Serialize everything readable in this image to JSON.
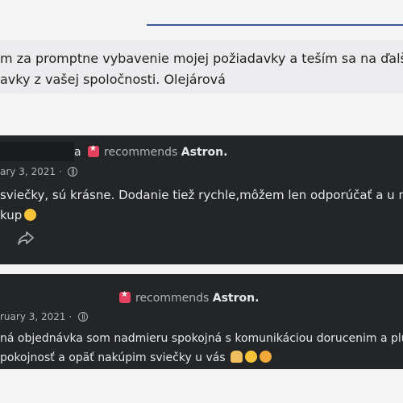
{
  "quote": {
    "line1": "m za promptne vybavenie mojej požiadavky a teším sa na ďalšie",
    "line2": "avky z vašej spoločnosti. Olejárová"
  },
  "reviews": [
    {
      "name_fragment": "a",
      "recommends": "recommends",
      "page": "Astron.",
      "date": "ary 3, 2021 ·",
      "text_line1": "sviečky, sú krásne. Dodanie tiež rychle,môžem len odporúčať a u mňa to",
      "text_line2": "kup"
    },
    {
      "recommends": "recommends",
      "page": "Astron.",
      "date": "ruary 3, 2021 ·",
      "text_line1": "ná objednávka som nadmieru spokojná s komunikáciou dorucenim a plus d",
      "text_line2": "pokojnosť a opäť nakúpim sviečky u vás"
    }
  ],
  "icons": {
    "recommend": "recommend-star-icon",
    "privacy": "globe-icon",
    "share": "share-icon",
    "colors": {
      "card_bg": "#242526",
      "accent": "#e4405f"
    }
  }
}
